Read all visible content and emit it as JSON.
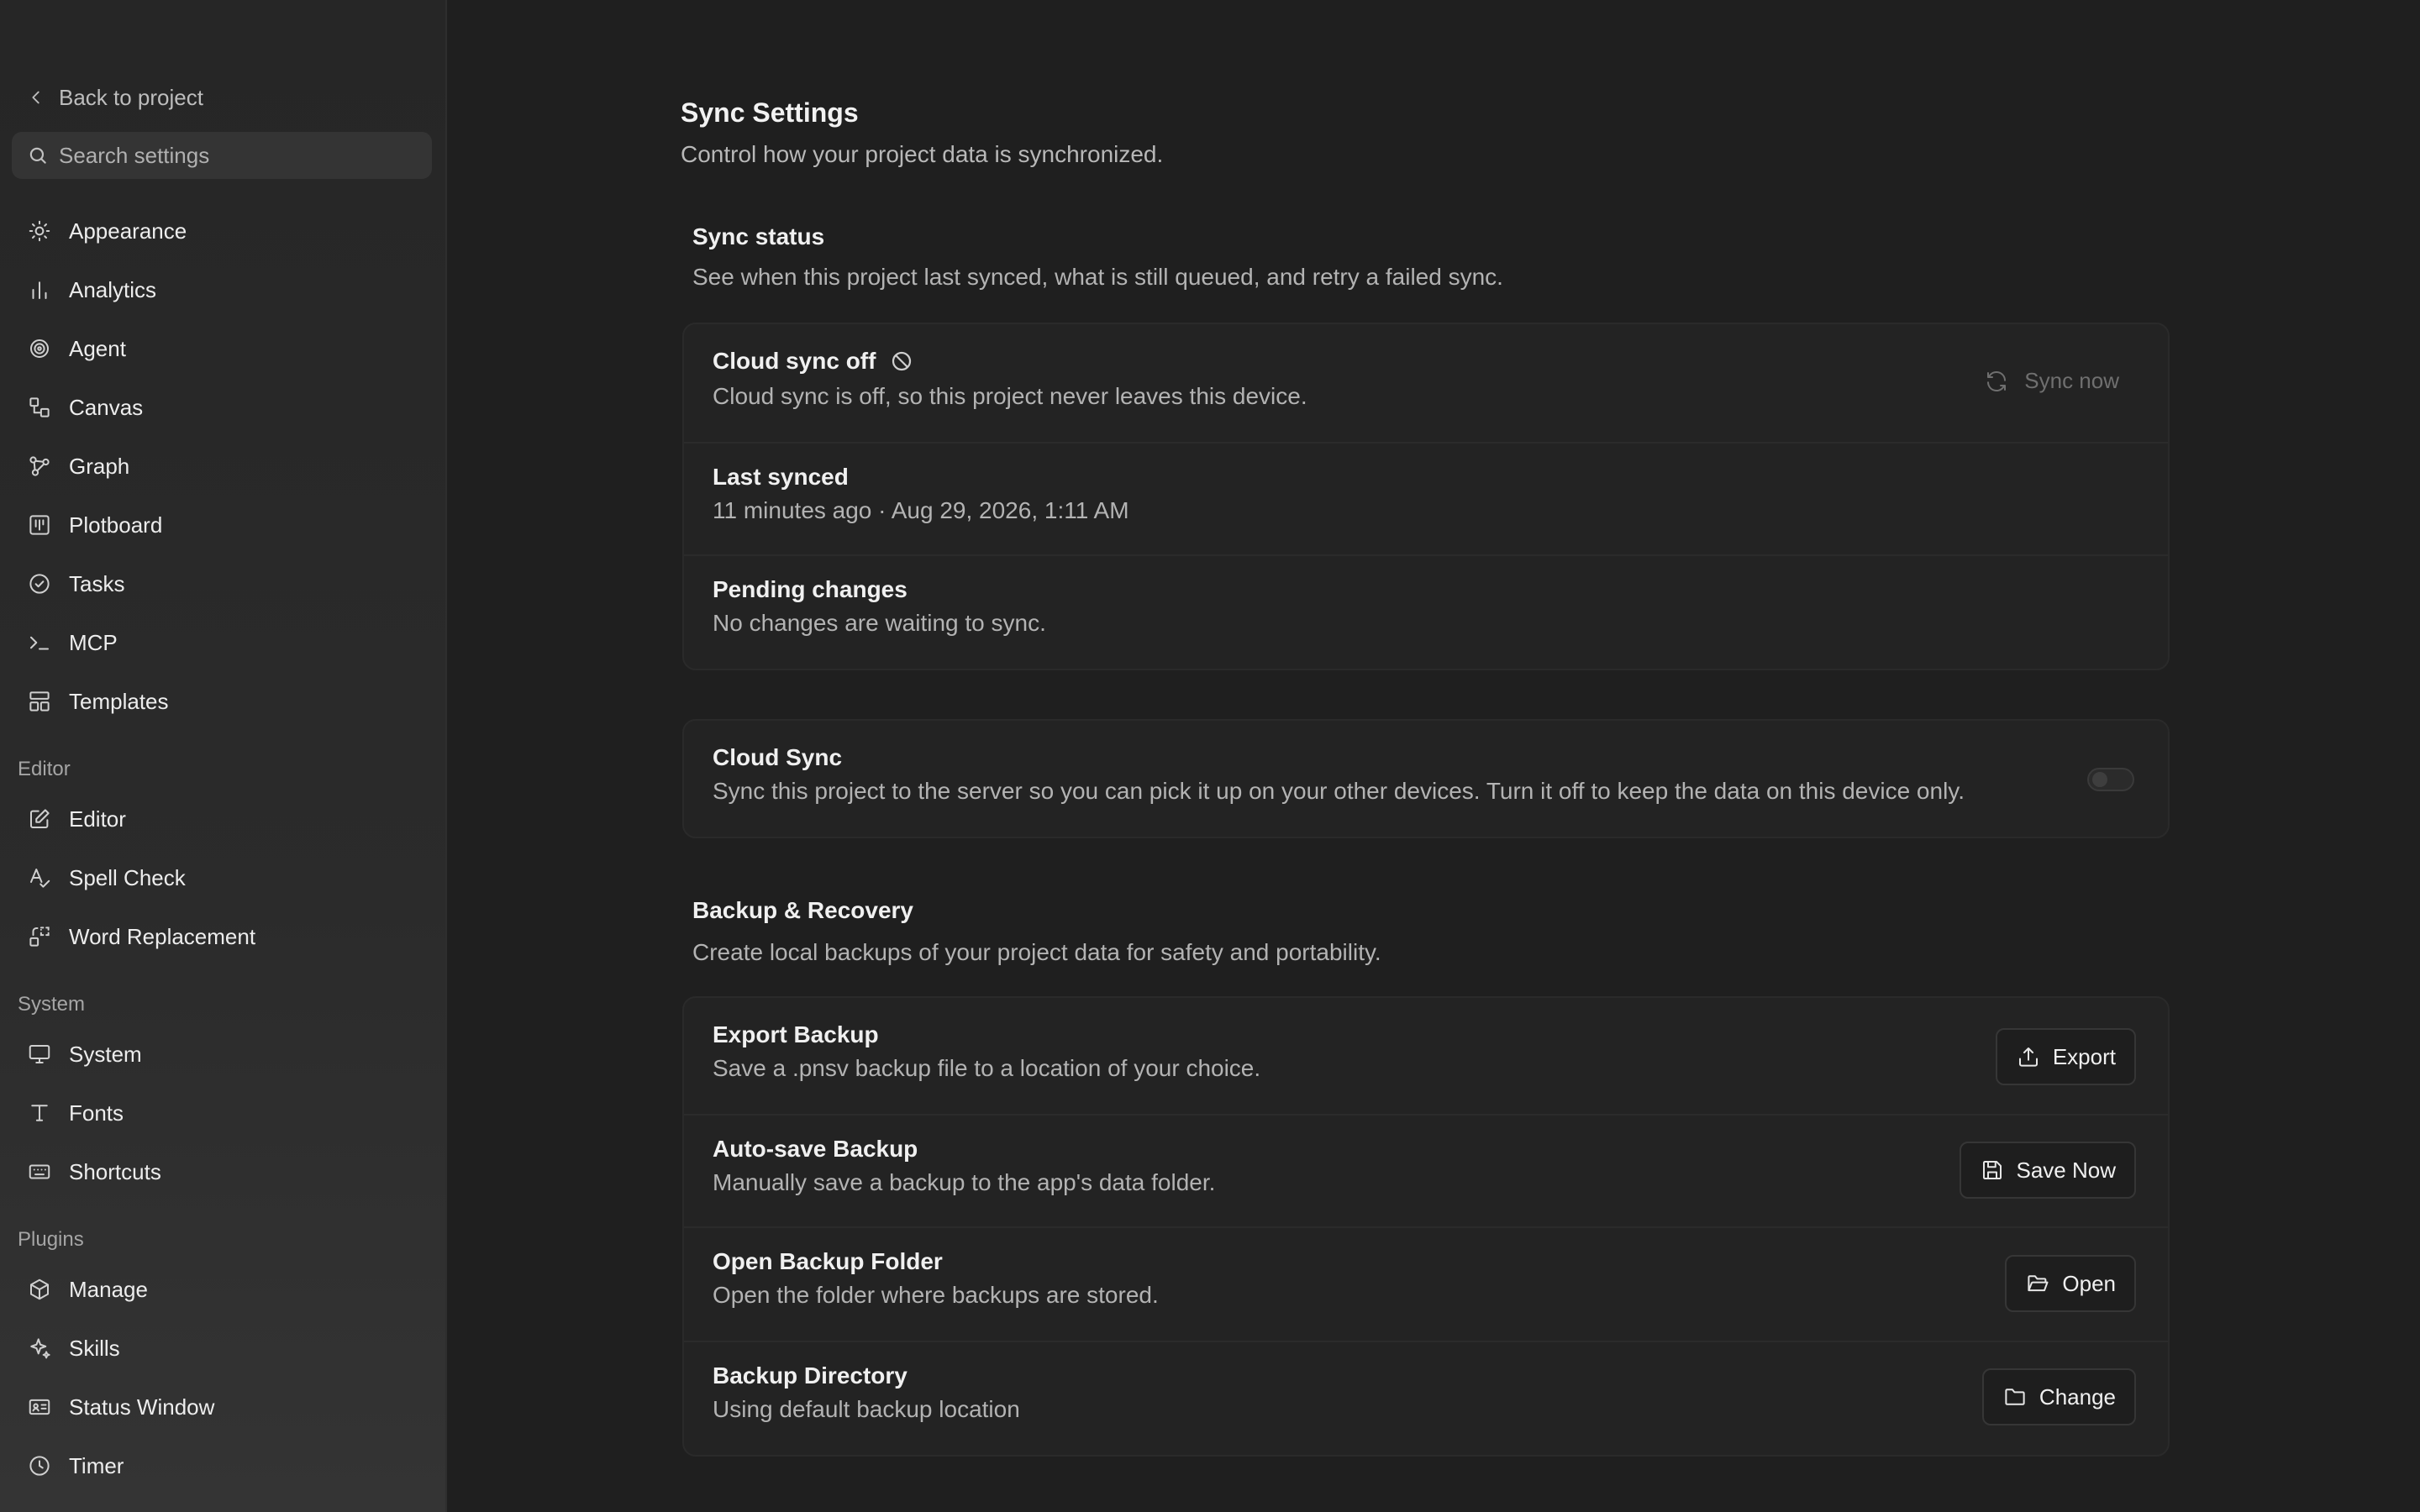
{
  "sidebar": {
    "back_label": "Back to project",
    "search_placeholder": "Search settings",
    "items": [
      {
        "label": "Appearance",
        "icon": "sun-icon"
      },
      {
        "label": "Analytics",
        "icon": "bar-chart-icon"
      },
      {
        "label": "Agent",
        "icon": "spiral-icon"
      },
      {
        "label": "Canvas",
        "icon": "shapes-icon"
      },
      {
        "label": "Graph",
        "icon": "graph-icon"
      },
      {
        "label": "Plotboard",
        "icon": "kanban-icon"
      },
      {
        "label": "Tasks",
        "icon": "check-circle-icon"
      },
      {
        "label": "MCP",
        "icon": "terminal-icon"
      },
      {
        "label": "Templates",
        "icon": "template-icon"
      }
    ],
    "groups": {
      "editor": {
        "label": "Editor",
        "items": [
          {
            "label": "Editor",
            "icon": "edit-icon"
          },
          {
            "label": "Spell Check",
            "icon": "spell-check-icon"
          },
          {
            "label": "Word Replacement",
            "icon": "replace-icon"
          }
        ]
      },
      "system": {
        "label": "System",
        "items": [
          {
            "label": "System",
            "icon": "monitor-icon"
          },
          {
            "label": "Fonts",
            "icon": "type-icon"
          },
          {
            "label": "Shortcuts",
            "icon": "keyboard-icon"
          }
        ]
      },
      "plugins": {
        "label": "Plugins",
        "items": [
          {
            "label": "Manage",
            "icon": "package-icon"
          },
          {
            "label": "Skills",
            "icon": "sparkles-icon"
          },
          {
            "label": "Status Window",
            "icon": "id-card-icon"
          },
          {
            "label": "Timer",
            "icon": "clock-icon"
          }
        ]
      }
    }
  },
  "main": {
    "title": "Sync Settings",
    "description": "Control how your project data is synchronized.",
    "sync_status": {
      "title": "Sync status",
      "description": "See when this project last synced, what is still queued, and retry a failed sync.",
      "rows": [
        {
          "title": "Cloud sync off",
          "desc": "Cloud sync is off, so this project never leaves this device.",
          "action": "Sync now"
        },
        {
          "title": "Last synced",
          "desc": "11 minutes ago · Aug 29, 2026, 1:11 AM"
        },
        {
          "title": "Pending changes",
          "desc": "No changes are waiting to sync."
        }
      ]
    },
    "cloud_sync": {
      "title": "Cloud Sync",
      "desc": "Sync this project to the server so you can pick it up on your other devices. Turn it off to keep the data on this device only.",
      "enabled": false
    },
    "backup": {
      "title": "Backup & Recovery",
      "description": "Create local backups of your project data for safety and portability.",
      "rows": [
        {
          "title": "Export Backup",
          "desc": "Save a .pnsv backup file to a location of your choice.",
          "button": "Export",
          "icon": "upload-icon"
        },
        {
          "title": "Auto-save Backup",
          "desc": "Manually save a backup to the app's data folder.",
          "button": "Save Now",
          "icon": "save-icon"
        },
        {
          "title": "Open Backup Folder",
          "desc": "Open the folder where backups are stored.",
          "button": "Open",
          "icon": "folder-open-icon"
        },
        {
          "title": "Backup Directory",
          "desc": "Using default backup location",
          "button": "Change",
          "icon": "folder-icon"
        }
      ]
    }
  },
  "colors": {
    "background": "#1f1f1f",
    "sidebar": "#2b2b2b",
    "card": "#232323",
    "text_primary": "#f0f0f0",
    "text_secondary": "#b3b3b3"
  }
}
